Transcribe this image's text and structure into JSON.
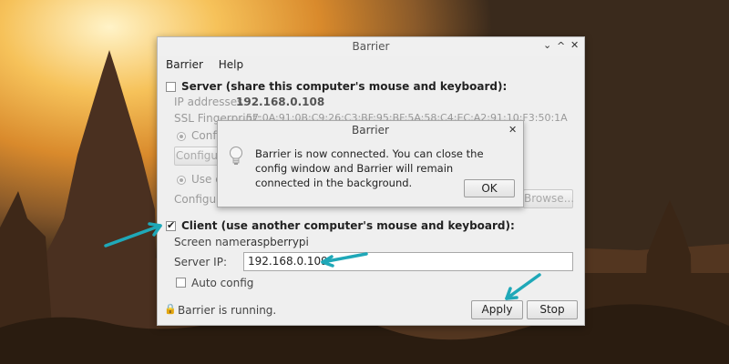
{
  "window": {
    "title": "Barrier",
    "controls": {
      "minimize": "⌄",
      "maximize": "^",
      "close": "✕"
    }
  },
  "menu": {
    "items": [
      "Barrier",
      "Help"
    ]
  },
  "server": {
    "checkbox_label": "Server (share this computer's mouse and keyboard):",
    "ip_label": "IP addresses:",
    "ip_value": "192.168.0.108",
    "ssl_label": "SSL Fingerprint:",
    "ssl_value": "57:0A:91:0B:C9:26:C3:BF:95:BF:5A:58:C4:EC:A2:91:10:F3:50:1A",
    "option_configure": "Config",
    "configure_button": "Configure",
    "option_use_existing": "Use ex",
    "configure_label": "Configura",
    "browse_button": "Browse..."
  },
  "client": {
    "checkbox_label": "Client (use another computer's mouse and keyboard):",
    "screen_name_label": "Screen name:",
    "screen_name_value": "raspberrypi",
    "server_ip_label": "Server IP:",
    "server_ip_value": "192.168.0.109",
    "auto_config_label": "Auto config"
  },
  "status": {
    "text": "Barrier is running."
  },
  "buttons": {
    "apply": "Apply",
    "stop": "Stop"
  },
  "dialog": {
    "title": "Barrier",
    "close": "✕",
    "message": "Barrier is now connected. You can close the config window and Barrier will remain connected in the background.",
    "ok": "OK"
  },
  "colors": {
    "arrow": "#1fa8b8",
    "window_bg": "#efefef"
  }
}
